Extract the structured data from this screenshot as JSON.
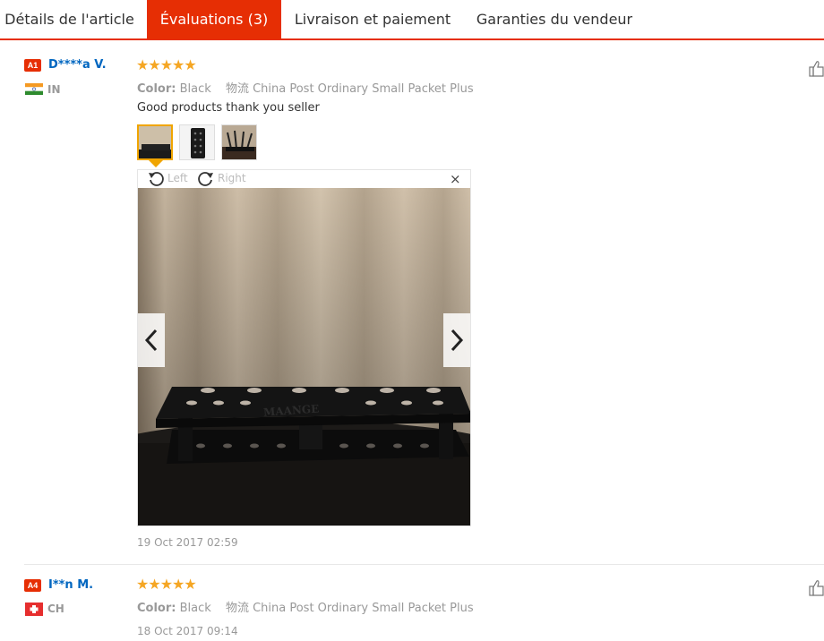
{
  "tabs": [
    {
      "label": "Détails de l'article"
    },
    {
      "label": "Évaluations (3)"
    },
    {
      "label": "Livraison et paiement"
    },
    {
      "label": "Garanties du vendeur"
    }
  ],
  "reviews": [
    {
      "badge": "A1",
      "name": "D****a V.",
      "country": "IN",
      "rating": 5,
      "stars": "★★★★★",
      "color_label": "Color:",
      "color_value": "Black",
      "shipping": "物流 China Post Ordinary Small Packet Plus",
      "text": "Good products thank you seller",
      "date": "19 Oct 2017 02:59"
    },
    {
      "badge": "A4",
      "name": "I**n M.",
      "country": "CH",
      "rating": 5,
      "stars": "★★★★★",
      "color_label": "Color:",
      "color_value": "Black",
      "shipping": "物流 China Post Ordinary Small Packet Plus",
      "date": "18 Oct 2017 09:14"
    }
  ],
  "viewer": {
    "rotate_left": "Left",
    "rotate_right": "Right",
    "close": "×",
    "product_text": "MAANGE"
  },
  "colors": {
    "accent": "#e62e04",
    "link": "#0066c0",
    "star": "#f5a623"
  }
}
